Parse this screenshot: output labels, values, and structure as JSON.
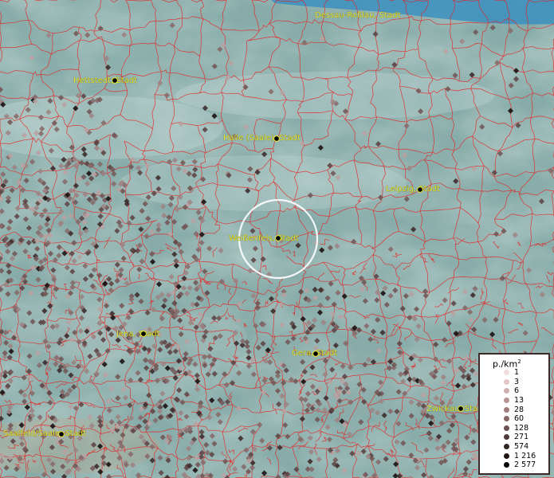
{
  "cities": [
    {
      "name": "Dessau-Roßlau, Stadt",
      "key": "dessau"
    },
    {
      "name": "Hettstedt, Stadt",
      "key": "hettstedt"
    },
    {
      "name": "Halle (Saale), Stadt",
      "key": "halle"
    },
    {
      "name": "Leipzig, Stadt",
      "key": "leipzig"
    },
    {
      "name": "Weißenfels, Stadt",
      "key": "weissenfels"
    },
    {
      "name": "Jena, Stadt",
      "key": "jena"
    },
    {
      "name": "Gera, Stadt",
      "key": "gera"
    },
    {
      "name": "Zwickau, Stadt",
      "key": "zwickau"
    },
    {
      "name": "Saalfeld/Saale, Stadt",
      "key": "saalfeld"
    }
  ],
  "legend": {
    "title": "p./km",
    "title_sup": "2",
    "items": [
      {
        "label": "1",
        "color": "#f2dede"
      },
      {
        "label": "3",
        "color": "#e2c6c6"
      },
      {
        "label": "6",
        "color": "#cfaeae"
      },
      {
        "label": "13",
        "color": "#b99494"
      },
      {
        "label": "28",
        "color": "#a07c7c"
      },
      {
        "label": "60",
        "color": "#866666"
      },
      {
        "label": "128",
        "color": "#6b5050"
      },
      {
        "label": "271",
        "color": "#4f3a3a"
      },
      {
        "label": "574",
        "color": "#352626"
      },
      {
        "label": "1 216",
        "color": "#1e1414"
      },
      {
        "label": "2 577",
        "color": "#070404"
      }
    ]
  },
  "colors": {
    "terrain": "#7fa7a3",
    "borders": "#e82020",
    "label_text": "#e8e830",
    "water": "#3b8fc0"
  }
}
